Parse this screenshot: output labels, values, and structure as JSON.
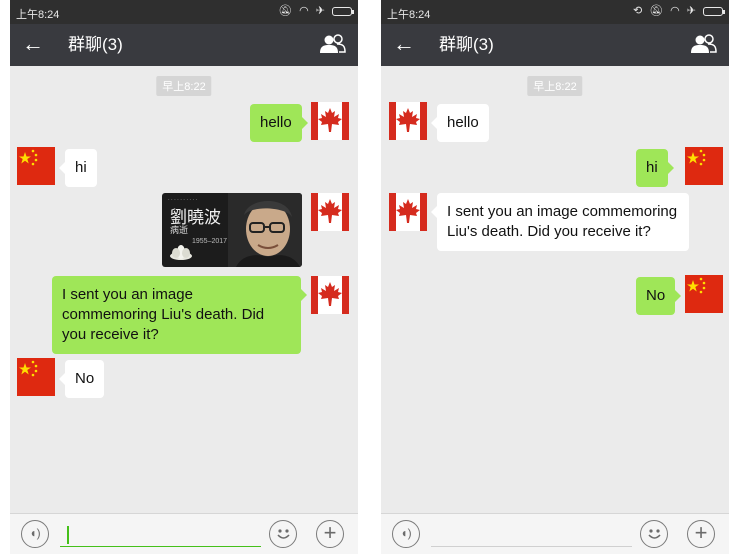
{
  "colors": {
    "titlebar": "#393a3f",
    "statusbar": "#2f2f2f",
    "chat_background": "#ebebeb",
    "sent_bubble": "#9fe658",
    "received_bubble": "#ffffff",
    "accent": "#45c01a"
  },
  "left_screen": {
    "status_time": "上午8:24",
    "title": "群聊(3)",
    "timestamp": "早上8:22",
    "messages": [
      {
        "from": "canada",
        "text": "hello"
      },
      {
        "from": "china",
        "text": "hi"
      },
      {
        "from": "canada",
        "type": "image",
        "image_title": "劉曉波",
        "image_subtitle": "病逝",
        "image_years": "1955–2017"
      },
      {
        "from": "canada",
        "text": "I sent you an image commemoring Liu's death. Did you receive it?"
      },
      {
        "from": "china",
        "text": "No"
      }
    ]
  },
  "right_screen": {
    "status_time": "上午8:24",
    "title": "群聊(3)",
    "timestamp": "早上8:22",
    "messages": [
      {
        "from": "canada",
        "text": "hello"
      },
      {
        "from": "china",
        "text": "hi"
      },
      {
        "from": "canada",
        "text": "I sent you an image commemoring Liu's death. Did you receive it?"
      },
      {
        "from": "china",
        "text": "No"
      }
    ]
  },
  "icons": {
    "back": "back-arrow-icon",
    "members": "group-members-icon",
    "voice": "voice-icon",
    "emoji": "emoji-icon",
    "plus": "plus-icon"
  }
}
